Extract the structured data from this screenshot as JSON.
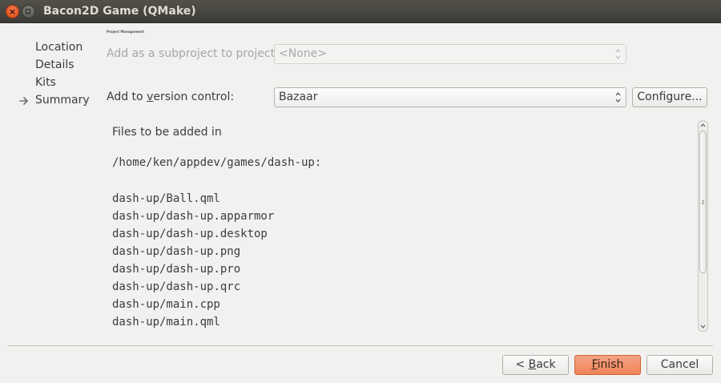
{
  "window": {
    "title": "Bacon2D Game (QMake)"
  },
  "sidebar": {
    "items": [
      {
        "label": "Location"
      },
      {
        "label": "Details"
      },
      {
        "label": "Kits"
      },
      {
        "label": "Summary",
        "current": true
      }
    ]
  },
  "page": {
    "title": "Project Management"
  },
  "subproject": {
    "label": "Add as a subproject to project:",
    "value": "<None>"
  },
  "version_control": {
    "label_pre": "Add to ",
    "label_mnemonic": "v",
    "label_post": "ersion control:",
    "value": "Bazaar",
    "configure_label": "Configure..."
  },
  "files": {
    "heading": "Files to be added in",
    "path": "/home/ken/appdev/games/dash-up:",
    "list": [
      "dash-up/Ball.qml",
      "dash-up/dash-up.apparmor",
      "dash-up/dash-up.desktop",
      "dash-up/dash-up.png",
      "dash-up/dash-up.pro",
      "dash-up/dash-up.qrc",
      "dash-up/main.cpp",
      "dash-up/main.qml"
    ]
  },
  "buttons": {
    "back_pre": "< ",
    "back_mnemonic": "B",
    "back_post": "ack",
    "finish_mnemonic": "F",
    "finish_post": "inish",
    "cancel": "Cancel"
  },
  "colors": {
    "titlebar": "#3c3b37",
    "close_button": "#e8572a",
    "finish_button": "#f0865a",
    "background": "#f2f1f0"
  }
}
